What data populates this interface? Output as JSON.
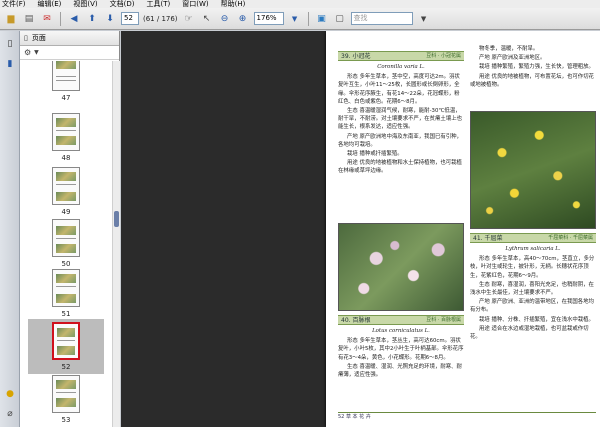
{
  "menu": [
    "文件(F)",
    "编辑(E)",
    "视图(V)",
    "文档(D)",
    "工具(T)",
    "窗口(W)",
    "帮助(H)"
  ],
  "toolbar": {
    "current_page": "52",
    "page_count": "(61 / 176)",
    "zoom": "176%",
    "search_placeholder": "查找"
  },
  "panel": {
    "title": "页面",
    "thumbnails": [
      "47",
      "48",
      "49",
      "50",
      "51",
      "52",
      "53"
    ],
    "selected": "52"
  },
  "page": {
    "footer": "52  草 本 花 卉",
    "entry39": {
      "title": "39. 小冠花",
      "tag": "豆科 · 小冠花属",
      "latin": "Coronilla varia L.",
      "paragraphs": [
        "形态  多年生草本，茎中空，高度可达2m。羽状复叶互生，小叶11～25枚，长圆形或长倒卵形，全缘。伞形花序腋生，有花14～22朵，花冠蝶形，粉红色、白色或紫色。花期6～8月。",
        "生态  喜温暖湿润气候，耐寒，能耐-30℃低温，耐干旱，不耐涝。对土壤要求不严，在贫瘠土壤上也能生长，根系发达，适应性强。",
        "产地  原产欧洲地中海及东南亚，我国已有引种，各地均可栽培。",
        "栽培  播种或扦插繁殖。",
        "用途  优良的地被植物和水土保持植物，也可栽植在林缘或草坪边缘。"
      ]
    },
    "entry40": {
      "title": "40. 百脉根",
      "tag": "豆科 · 百脉根属",
      "latin": "Lotus corniculatus L.",
      "paragraphs": [
        "形态  多年生草本，茎丛生，高可达60cm。羽状复叶，小叶5枚，其中2小叶生于叶柄基部。伞形花序有花3～4朵，黄色，小花蝶形。花期6～8月。",
        "生态  喜温暖、湿润、光照充足的环境，耐寒、耐瘠薄，适应性强。"
      ]
    },
    "entry41": {
      "title": "41. 千屈菜",
      "tag": "千屈菜科 · 千屈菜属",
      "latin": "Lythrum salicaria L.",
      "paragraphs": [
        "形态  多年生草本，高40～70cm，茎直立，多分枝，叶对生或轮生，披针形，无柄。长穗状花序顶生，花紫红色，花期6～9月。",
        "生态  耐寒，喜湿润，喜阳光充足，也稍耐阴，在浅水中生长最佳，对土壤要求不严。",
        "产地  原产欧洲、亚洲的温带地区，在我国各地均有分布。",
        "栽培  播种、分株、扦插繁殖，宜在浅水中栽植。",
        "用途  适合在水边或湿地栽植，也可盆栽或作切花。"
      ]
    },
    "right_top": [
      "物冬季，温暖，不耐旱。",
      "产地  原产欧洲及亚洲地区。",
      "栽培  播种繁殖，繁殖力强，生长快，管理粗放。",
      "用途  优良的地被植物，可布置花坛，也可作切花或地被植物。"
    ]
  }
}
